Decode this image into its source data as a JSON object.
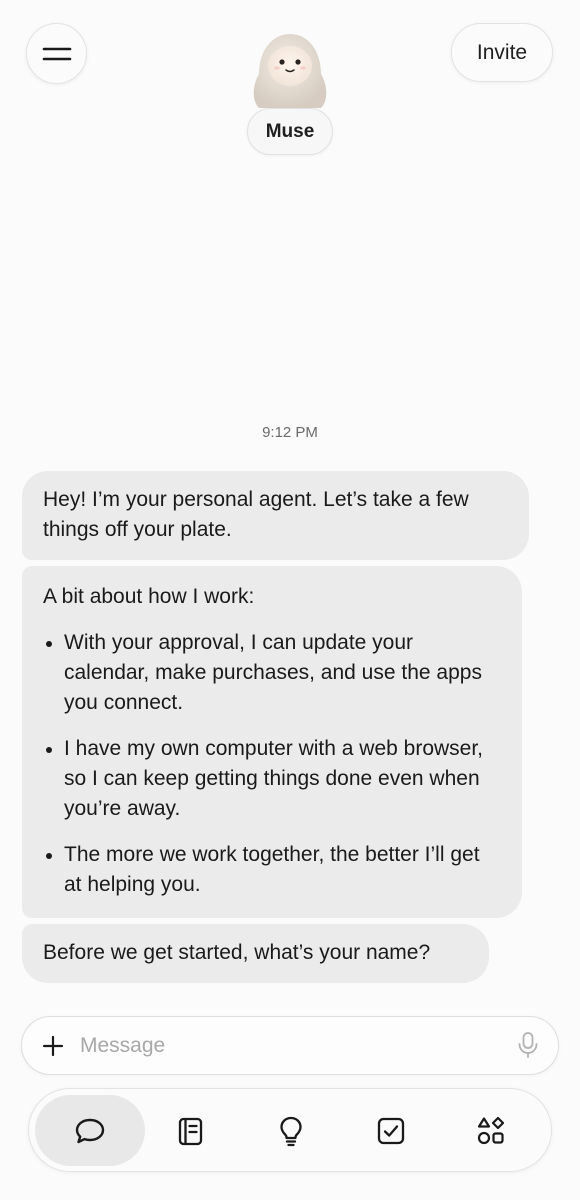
{
  "header": {
    "agent_name": "Muse",
    "invite_label": "Invite"
  },
  "chat": {
    "timestamp": "9:12 PM",
    "message1": "Hey! I’m your personal agent. Let’s take a few things off your plate.",
    "message2": {
      "intro": "A bit about how I work:",
      "bullets": [
        "With your approval, I can update your calendar, make purchases, and use the apps you connect.",
        "I have my own computer with a web browser, so I can keep getting things done even when you’re away.",
        "The more we work together, the better I’ll get at helping you."
      ]
    },
    "message3": "Before we get started, what’s your name?"
  },
  "composer": {
    "placeholder": "Message",
    "value": ""
  },
  "tabs": [
    {
      "icon": "chat-bubble-icon",
      "active": true
    },
    {
      "icon": "notebook-icon",
      "active": false
    },
    {
      "icon": "lightbulb-icon",
      "active": false
    },
    {
      "icon": "checkbox-icon",
      "active": false
    },
    {
      "icon": "apps-grid-icon",
      "active": false
    }
  ],
  "colors": {
    "background": "#fbfbfb",
    "bubble": "#ebebeb",
    "active_tab": "#e8e8e8",
    "placeholder": "#a8a8a8"
  }
}
